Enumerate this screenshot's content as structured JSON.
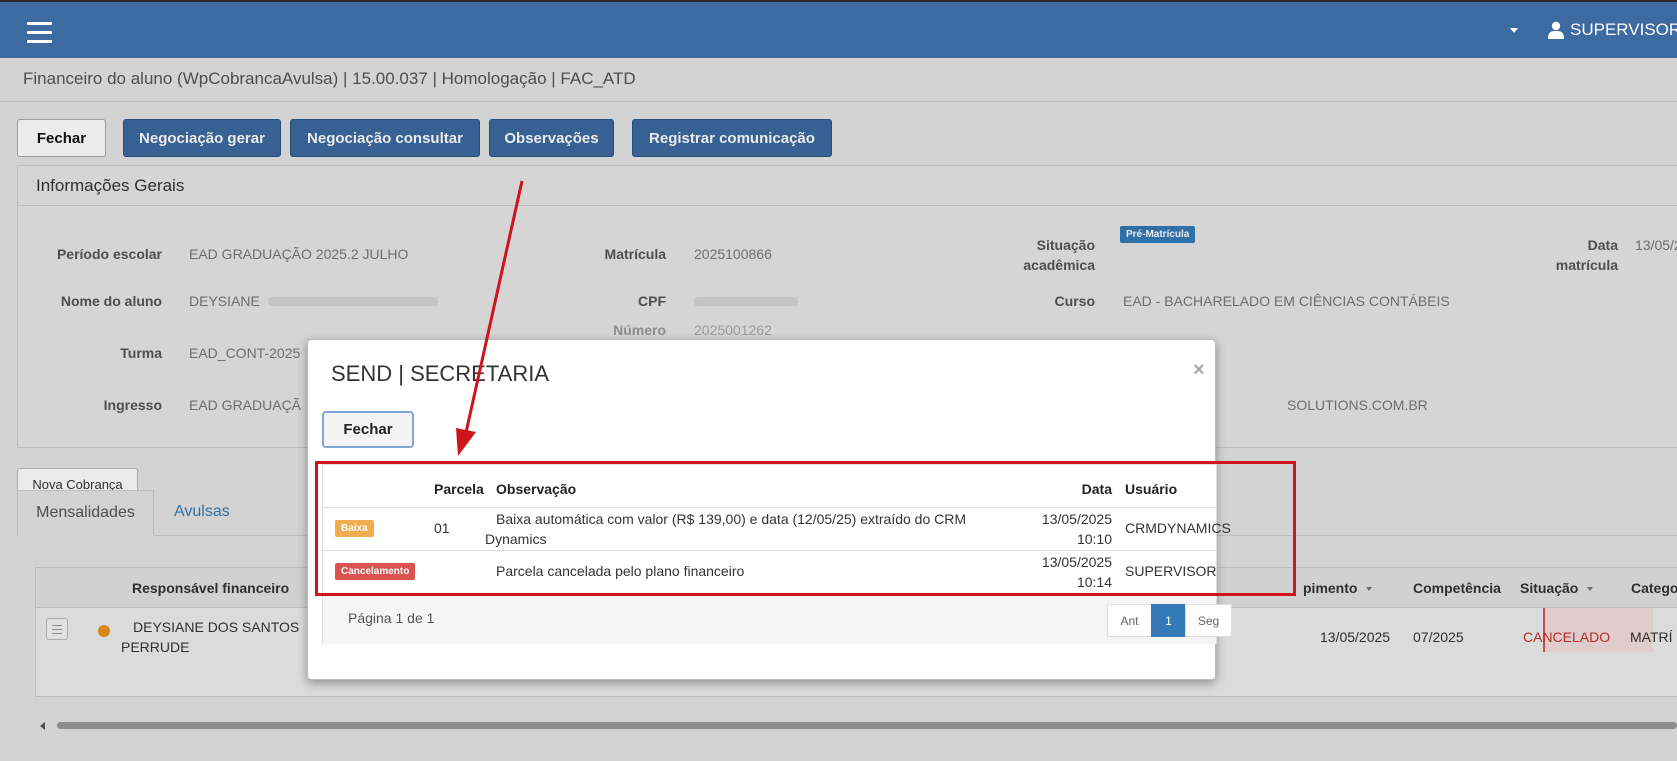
{
  "topbar": {
    "user_label": "SUPERVISOR",
    "colors": {
      "bar": "#3d6aa1"
    }
  },
  "breadcrumb": "Financeiro do aluno (WpCobrancaAvulsa) | 15.00.037 | Homologação | FAC_ATD",
  "toolbar": {
    "fechar": "Fechar",
    "negociacao_gerar": "Negociação gerar",
    "negociacao_consultar": "Negociação consultar",
    "observacoes": "Observações",
    "registrar_comunicacao": "Registrar comunicação"
  },
  "info": {
    "title": "Informações Gerais",
    "periodo_label": "Período escolar",
    "periodo_value": "EAD GRADUAÇÃO 2025.2 JULHO",
    "matricula_label": "Matrícula",
    "matricula_value": "2025100866",
    "situacao_label_1": "Situação",
    "situacao_label_2": "acadêmica",
    "situacao_badge": "Pré-Matrícula",
    "data_label_1": "Data",
    "data_label_2": "matrícula",
    "data_value": "13/05/2",
    "nome_label": "Nome do aluno",
    "nome_value": "DEYSIANE",
    "cpf_label": "CPF",
    "curso_label": "Curso",
    "curso_value": "EAD - BACHARELADO EM CIÊNCIAS CONTÁBEIS",
    "numero_label": "Número",
    "numero_value": "2025001262",
    "turma_label": "Turma",
    "turma_value": "EAD_CONT-2025",
    "ingresso_label": "Ingresso",
    "ingresso_value": "EAD GRADUAÇÃ",
    "email_value": "SOLUTIONS.COM.BR"
  },
  "nova_cobranca": "Nova Cobrança",
  "tabs": {
    "mensalidades": "Mensalidades",
    "avulsas": "Avulsas"
  },
  "grid": {
    "headers": {
      "responsavel": "Responsável financeiro",
      "vencimento": "pimento",
      "competencia": "Competência",
      "situacao": "Situação",
      "categoria": "Catego"
    },
    "row": {
      "responsavel_1": "DEYSIANE DOS SANTOS",
      "responsavel_2": "PERRUDE",
      "vencimento": "13/05/2025",
      "competencia": "07/2025",
      "situacao": "CANCELADO",
      "categoria": "MATRÍ"
    }
  },
  "modal": {
    "title": "SEND | SECRETARIA",
    "close": "×",
    "fechar": "Fechar",
    "headers": {
      "parcela": "Parcela",
      "observacao": "Observação",
      "data": "Data",
      "usuario": "Usuário"
    },
    "rows": [
      {
        "tag": "Baixa",
        "tag_color": "#f0ad4e",
        "parcela": "01",
        "obs_1": "Baixa automática com valor (R$ 139,00) e data (12/05/25) extraído do CRM",
        "obs_2": "Dynamics",
        "date": "13/05/2025",
        "time": "10:10",
        "usuario": "CRMDYNAMICS"
      },
      {
        "tag": "Cancelamento",
        "tag_color": "#d9534f",
        "parcela": "",
        "obs_1": "Parcela cancelada pelo plano financeiro",
        "obs_2": "",
        "date": "13/05/2025",
        "time": "10:14",
        "usuario": "SUPERVISOR"
      }
    ],
    "pager": {
      "info": "Página 1 de 1",
      "prev": "Ant",
      "current": "1",
      "next": "Seg"
    }
  },
  "annotation": {
    "box_color": "#d0141b",
    "arrow_color": "#d0141b"
  }
}
